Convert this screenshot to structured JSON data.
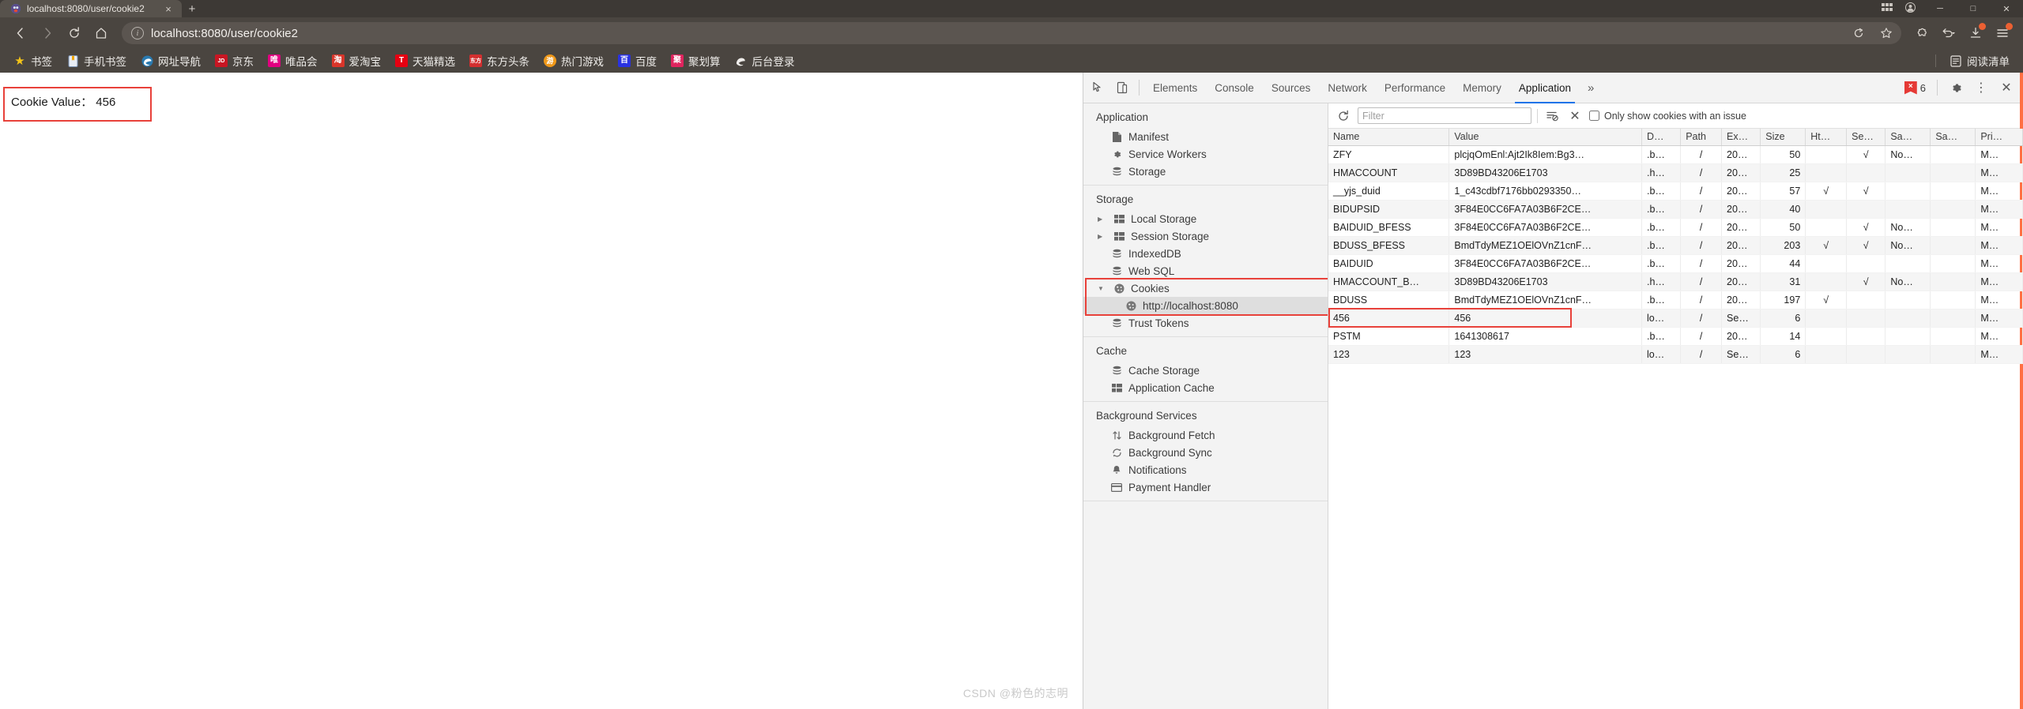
{
  "browser": {
    "tab": {
      "title": "localhost:8080/user/cookie2",
      "favicon": "browser-logo-icon",
      "close": "×"
    },
    "new_tab": "+",
    "window_controls": {
      "minimize": "─",
      "maximize": "□",
      "close": "✕"
    },
    "titlebar_misc": [
      "☰",
      "◯"
    ],
    "nav": {
      "back": "‹",
      "forward": "›",
      "reload": "⟳",
      "home": "⌂"
    },
    "omnibox": {
      "site_info": "i",
      "url": "localhost:8080/user/cookie2",
      "share_icon": "↺",
      "bookmark_icon": "☆"
    },
    "nav_right": {
      "extensions": "puzzle-piece",
      "history_back": "↶",
      "downloads": "↓",
      "menu": "≡"
    },
    "bookmarks": [
      {
        "label": "书签",
        "icon": "★",
        "icon_type": "star",
        "color": "#f5c518"
      },
      {
        "label": "手机书签",
        "icon": "▮",
        "icon_type": "phone",
        "color": "#4a90d9"
      },
      {
        "label": "网址导航",
        "icon": "e",
        "icon_type": "edge",
        "color": "#2a7ab0"
      },
      {
        "label": "京东",
        "icon": "JD",
        "icon_type": "square",
        "color": "#c81623"
      },
      {
        "label": "唯品会",
        "icon": "唯",
        "icon_type": "square",
        "color": "#e10080"
      },
      {
        "label": "爱淘宝",
        "icon": "淘",
        "icon_type": "square",
        "color": "#d9352a"
      },
      {
        "label": "天猫精选",
        "icon": "T",
        "icon_type": "square",
        "color": "#e60012"
      },
      {
        "label": "东方头条",
        "icon": "东方",
        "icon_type": "square",
        "color": "#d32f2f"
      },
      {
        "label": "热门游戏",
        "icon": "游",
        "icon_type": "circle",
        "color": "#f09819"
      },
      {
        "label": "百度",
        "icon": "百",
        "icon_type": "square",
        "color": "#2932e1"
      },
      {
        "label": "聚划算",
        "icon": "聚",
        "icon_type": "square",
        "color": "#e0245e"
      },
      {
        "label": "后台登录",
        "icon": "e",
        "icon_type": "edge-white",
        "color": "#f2f2f2"
      }
    ],
    "reading_list": {
      "label": "阅读清单",
      "icon": "☰"
    }
  },
  "page": {
    "cookie_text": "Cookie Value： 456",
    "watermark": "CSDN @粉色的志明"
  },
  "devtools": {
    "toolbar_icons": {
      "inspect": "⬚",
      "device": "▯"
    },
    "tabs": [
      {
        "label": "Elements",
        "active": false
      },
      {
        "label": "Console",
        "active": false
      },
      {
        "label": "Sources",
        "active": false
      },
      {
        "label": "Network",
        "active": false
      },
      {
        "label": "Performance",
        "active": false
      },
      {
        "label": "Memory",
        "active": false
      },
      {
        "label": "Application",
        "active": true
      }
    ],
    "more_tabs": "»",
    "error_count": "6",
    "error_mark": "×",
    "settings_icon": "⚙",
    "kebab_icon": "⋮",
    "close_icon": "✕",
    "sidebar": {
      "groups": [
        {
          "title": "Application",
          "items": [
            {
              "label": "Manifest",
              "icon": "manifest-page-icon",
              "glyph": "◧",
              "arrow": false,
              "selected": false,
              "nested": false
            },
            {
              "label": "Service Workers",
              "icon": "gear-icon",
              "glyph": "⚙",
              "arrow": false,
              "selected": false,
              "nested": false
            },
            {
              "label": "Storage",
              "icon": "database-icon",
              "glyph": "☲",
              "arrow": false,
              "selected": false,
              "nested": false
            }
          ]
        },
        {
          "title": "Storage",
          "items": [
            {
              "label": "Local Storage",
              "icon": "table-icon",
              "glyph": "▦",
              "arrow": true,
              "selected": false,
              "nested": false
            },
            {
              "label": "Session Storage",
              "icon": "table-icon",
              "glyph": "▦",
              "arrow": true,
              "selected": false,
              "nested": false
            },
            {
              "label": "IndexedDB",
              "icon": "database-icon",
              "glyph": "☲",
              "arrow": false,
              "selected": false,
              "nested": false
            },
            {
              "label": "Web SQL",
              "icon": "database-icon",
              "glyph": "☲",
              "arrow": false,
              "selected": false,
              "nested": false
            },
            {
              "label": "Cookies",
              "icon": "cookie-icon",
              "glyph": "●",
              "arrow": true,
              "expanded": true,
              "selected": false,
              "nested": false
            },
            {
              "label": "http://localhost:8080",
              "icon": "cookie-icon",
              "glyph": "●",
              "arrow": false,
              "selected": true,
              "nested": true
            },
            {
              "label": "Trust Tokens",
              "icon": "database-icon",
              "glyph": "☲",
              "arrow": false,
              "selected": false,
              "nested": false
            }
          ]
        },
        {
          "title": "Cache",
          "items": [
            {
              "label": "Cache Storage",
              "icon": "database-icon",
              "glyph": "☲",
              "arrow": false,
              "selected": false,
              "nested": false
            },
            {
              "label": "Application Cache",
              "icon": "table-icon",
              "glyph": "▦",
              "arrow": false,
              "selected": false,
              "nested": false
            }
          ]
        },
        {
          "title": "Background Services",
          "items": [
            {
              "label": "Background Fetch",
              "icon": "arrows-updown-icon",
              "glyph": "⇅",
              "arrow": false,
              "selected": false,
              "nested": false
            },
            {
              "label": "Background Sync",
              "icon": "sync-icon",
              "glyph": "↻",
              "arrow": false,
              "selected": false,
              "nested": false
            },
            {
              "label": "Notifications",
              "icon": "bell-icon",
              "glyph": "ὑ4",
              "arrow": false,
              "selected": false,
              "nested": false
            },
            {
              "label": "Payment Handler",
              "icon": "card-icon",
              "glyph": "▭",
              "arrow": false,
              "selected": false,
              "nested": false
            }
          ]
        }
      ]
    },
    "cookie_toolbar": {
      "refresh_icon": "⟳",
      "filter_placeholder": "Filter",
      "clear_filter_icon": "☰",
      "delete_all_icon": "✕",
      "only_issues_label": "Only show cookies with an issue"
    },
    "table": {
      "columns": [
        "Name",
        "Value",
        "D…",
        "Path",
        "Ex…",
        "Size",
        "Ht…",
        "Se…",
        "Sa…",
        "Sa…",
        "Pri…"
      ],
      "rows": [
        {
          "name": "ZFY",
          "value": "plcjqOmEnl:Ajt2Ik8Iem:Bg3…",
          "domain": ".b…",
          "path": "/",
          "expires": "20…",
          "size": "50",
          "httponly": "",
          "secure": "√",
          "samesite": "No…",
          "samepart": "",
          "priority": "M…"
        },
        {
          "name": "HMACCOUNT",
          "value": "3D89BD43206E1703",
          "domain": ".h…",
          "path": "/",
          "expires": "20…",
          "size": "25",
          "httponly": "",
          "secure": "",
          "samesite": "",
          "samepart": "",
          "priority": "M…"
        },
        {
          "name": "__yjs_duid",
          "value": "1_c43cdbf7176bb0293350…",
          "domain": ".b…",
          "path": "/",
          "expires": "20…",
          "size": "57",
          "httponly": "√",
          "secure": "√",
          "samesite": "",
          "samepart": "",
          "priority": "M…"
        },
        {
          "name": "BIDUPSID",
          "value": "3F84E0CC6FA7A03B6F2CE…",
          "domain": ".b…",
          "path": "/",
          "expires": "20…",
          "size": "40",
          "httponly": "",
          "secure": "",
          "samesite": "",
          "samepart": "",
          "priority": "M…"
        },
        {
          "name": "BAIDUID_BFESS",
          "value": "3F84E0CC6FA7A03B6F2CE…",
          "domain": ".b…",
          "path": "/",
          "expires": "20…",
          "size": "50",
          "httponly": "",
          "secure": "√",
          "samesite": "No…",
          "samepart": "",
          "priority": "M…"
        },
        {
          "name": "BDUSS_BFESS",
          "value": "BmdTdyMEZ1OElOVnZ1cnF…",
          "domain": ".b…",
          "path": "/",
          "expires": "20…",
          "size": "203",
          "httponly": "√",
          "secure": "√",
          "samesite": "No…",
          "samepart": "",
          "priority": "M…"
        },
        {
          "name": "BAIDUID",
          "value": "3F84E0CC6FA7A03B6F2CE…",
          "domain": ".b…",
          "path": "/",
          "expires": "20…",
          "size": "44",
          "httponly": "",
          "secure": "",
          "samesite": "",
          "samepart": "",
          "priority": "M…"
        },
        {
          "name": "HMACCOUNT_B…",
          "value": "3D89BD43206E1703",
          "domain": ".h…",
          "path": "/",
          "expires": "20…",
          "size": "31",
          "httponly": "",
          "secure": "√",
          "samesite": "No…",
          "samepart": "",
          "priority": "M…"
        },
        {
          "name": "BDUSS",
          "value": "BmdTdyMEZ1OElOVnZ1cnF…",
          "domain": ".b…",
          "path": "/",
          "expires": "20…",
          "size": "197",
          "httponly": "√",
          "secure": "",
          "samesite": "",
          "samepart": "",
          "priority": "M…"
        },
        {
          "name": "456",
          "value": "456",
          "domain": "lo…",
          "path": "/",
          "expires": "Se…",
          "size": "6",
          "httponly": "",
          "secure": "",
          "samesite": "",
          "samepart": "",
          "priority": "M…"
        },
        {
          "name": "PSTM",
          "value": "1641308617",
          "domain": ".b…",
          "path": "/",
          "expires": "20…",
          "size": "14",
          "httponly": "",
          "secure": "",
          "samesite": "",
          "samepart": "",
          "priority": "M…"
        },
        {
          "name": "123",
          "value": "123",
          "domain": "lo…",
          "path": "/",
          "expires": "Se…",
          "size": "6",
          "httponly": "",
          "secure": "",
          "samesite": "",
          "samepart": "",
          "priority": "M…"
        }
      ],
      "highlighted_row_index": 9
    }
  },
  "colors": {
    "chrome_bg": "#4a4540",
    "accent_blue": "#1a73e8",
    "highlight_red": "#e8413a",
    "error_red": "#e53935"
  }
}
